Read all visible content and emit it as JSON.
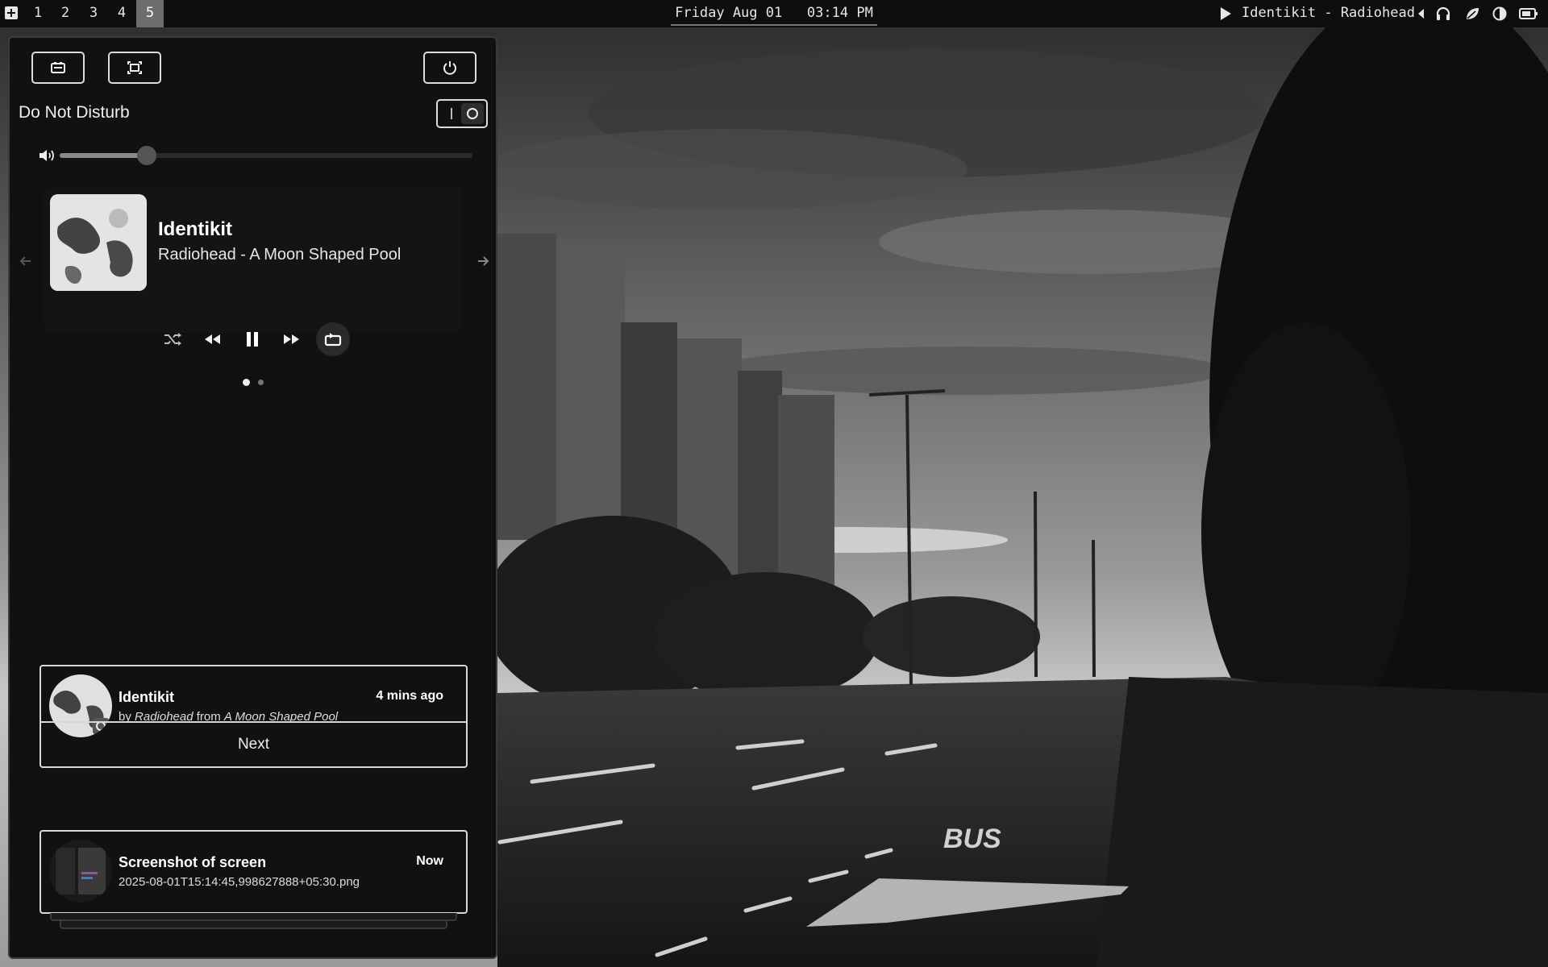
{
  "topbar": {
    "workspaces": [
      "1",
      "2",
      "3",
      "4",
      "5"
    ],
    "active_workspace": "5",
    "clock": "Friday Aug 01   03:14 PM",
    "now_playing": "Identikit - Radiohead",
    "icons": [
      "app-launcher-icon",
      "play-icon",
      "chevron-left-icon",
      "headphones-icon",
      "leaf-icon",
      "contrast-icon",
      "battery-icon"
    ]
  },
  "sidebar": {
    "buttons": [
      "battery-saver-icon",
      "screenshot-icon",
      "power-icon"
    ],
    "dnd": {
      "label": "Do Not Disturb",
      "enabled": false
    },
    "volume": {
      "level_percent": 21
    },
    "media": {
      "title": "Identikit",
      "subtitle": "Radiohead - A Moon Shaped Pool",
      "controls": [
        "shuffle-icon",
        "rewind-icon",
        "pause-icon",
        "fast-forward-icon",
        "repeat-icon"
      ],
      "pages": 2,
      "active_page": 1
    },
    "notifications": [
      {
        "title": "Identikit",
        "body_prefix": "by ",
        "artist": "Radiohead",
        "body_mid": " from ",
        "album": "A Moon Shaped Pool",
        "time": "4 mins ago",
        "action": "Next"
      },
      {
        "title": "Screenshot of screen",
        "body": "2025-08-01T15:14:45,998627888+05:30.png",
        "time": "Now"
      }
    ]
  },
  "colors": {
    "accent": "#6d6d6d",
    "panel_bg": "#111111",
    "border": "#d8d8d8"
  }
}
